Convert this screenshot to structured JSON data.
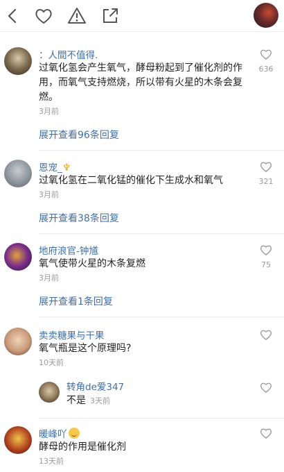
{
  "topbar": {
    "icons": [
      "back-icon",
      "heart-icon",
      "warning-icon",
      "share-icon"
    ],
    "avatar": "user-avatar"
  },
  "comments": [
    {
      "username": "：人間不值得.",
      "text": "过氧化氢会产生氧气，酵母粉起到了催化剂的作用，而氧气支持燃烧，所以带有火星的木条会复燃。",
      "time": "3月前",
      "likes": "636",
      "expand": "展开查看96条回复"
    },
    {
      "username": "恩宠_",
      "badge": "trident",
      "text": "过氧化氢在二氧化锰的催化下生成水和氧气",
      "time": "3月前",
      "likes": "321",
      "expand": "展开查看38条回复"
    },
    {
      "username": "地府浪官-钟馗",
      "text": "氧气使带火星的木条复燃",
      "time": "3月前",
      "likes": "75",
      "expand": "展开查看1条回复"
    },
    {
      "username": "卖卖糖果与干果",
      "text": "氧气瓶是这个原理吗?",
      "time": "10天前",
      "likes": "",
      "reply": {
        "username": "转角de爱347",
        "text": "不是",
        "time": "3天前"
      }
    },
    {
      "username": "暖峰吖",
      "badge": "smile",
      "text": "酵母的作用是催化剂",
      "time": "13天前",
      "likes": ""
    }
  ],
  "colors": {
    "link": "#3f6fa6",
    "muted": "#9a9a9a",
    "text": "#222222"
  }
}
